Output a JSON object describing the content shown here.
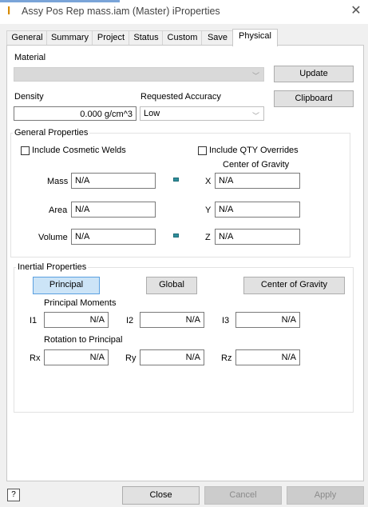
{
  "window": {
    "title": "Assy Pos Rep mass.iam (Master) iProperties",
    "close_glyph": "✕",
    "icon_glyph": "I"
  },
  "tabs": [
    "General",
    "Summary",
    "Project",
    "Status",
    "Custom",
    "Save",
    "Physical"
  ],
  "active_tab": "Physical",
  "material": {
    "label": "Material",
    "value": "",
    "update_button": "Update"
  },
  "density": {
    "label": "Density",
    "value": "0.000 g/cm^3"
  },
  "accuracy": {
    "label": "Requested Accuracy",
    "value": "Low"
  },
  "clipboard_button": "Clipboard",
  "general_properties": {
    "title": "General Properties",
    "include_welds": "Include Cosmetic Welds",
    "include_qty": "Include QTY Overrides",
    "cog_label": "Center of Gravity",
    "mass_label": "Mass",
    "mass_value": "N/A",
    "area_label": "Area",
    "area_value": "N/A",
    "volume_label": "Volume",
    "volume_value": "N/A",
    "x_label": "X",
    "x_value": "N/A",
    "y_label": "Y",
    "y_value": "N/A",
    "z_label": "Z",
    "z_value": "N/A"
  },
  "inertial_properties": {
    "title": "Inertial Properties",
    "principal_button": "Principal",
    "global_button": "Global",
    "cog_button": "Center of Gravity",
    "moments_label": "Principal Moments",
    "i1_label": "I1",
    "i1_value": "N/A",
    "i2_label": "I2",
    "i2_value": "N/A",
    "i3_label": "I3",
    "i3_value": "N/A",
    "rotation_label": "Rotation to Principal",
    "rx_label": "Rx",
    "rx_value": "N/A",
    "ry_label": "Ry",
    "ry_value": "N/A",
    "rz_label": "Rz",
    "rz_value": "N/A"
  },
  "footer": {
    "help_glyph": "?",
    "close_button": "Close",
    "cancel_button": "Cancel",
    "apply_button": "Apply"
  }
}
